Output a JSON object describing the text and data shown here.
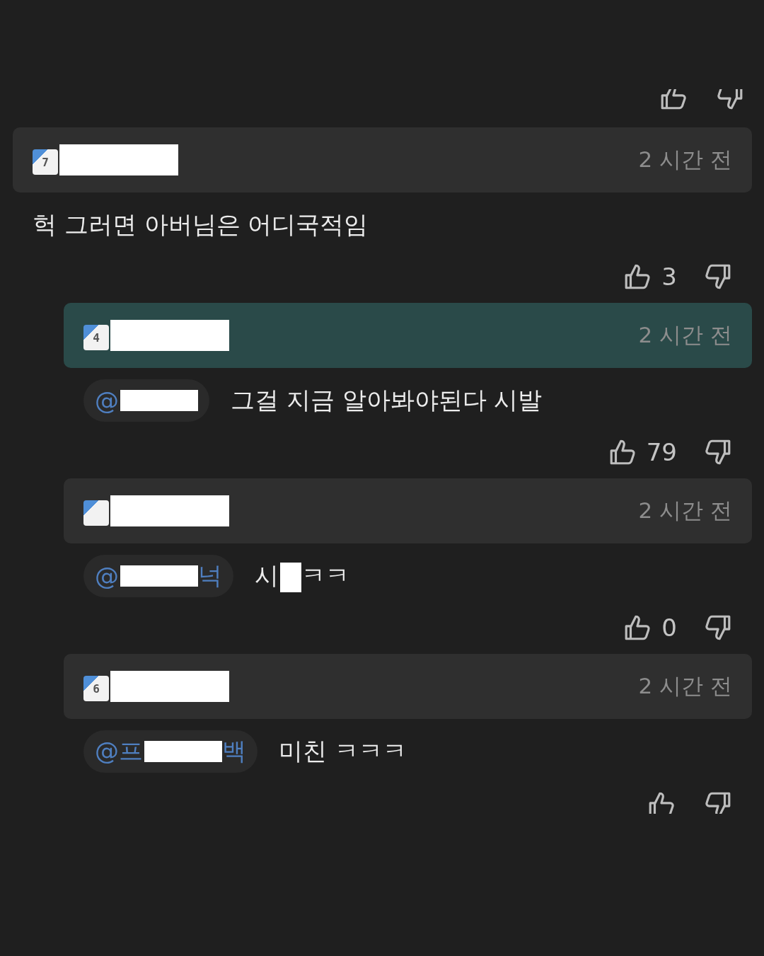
{
  "top_actions": {
    "kind": "cut-top"
  },
  "comments": [
    {
      "reply": false,
      "highlighted": false,
      "level": "7",
      "time": "2 시간 전",
      "text_start": "헉 그러면 아버님은 어디국적임",
      "actions": {
        "kind": "full",
        "likes": "3"
      }
    },
    {
      "reply": true,
      "highlighted": true,
      "level": "4",
      "time": "2 시간 전",
      "mention_start": "@",
      "text_start": "그걸 지금 알아봐야된다 시발",
      "actions": {
        "kind": "full",
        "likes": "79"
      }
    },
    {
      "reply": true,
      "highlighted": false,
      "time": "2 시간 전",
      "mention_start": "@",
      "mention_end": "넉",
      "text_start": "시",
      "text_end": "ㅋㅋ",
      "actions": {
        "kind": "full",
        "likes": "0"
      }
    },
    {
      "reply": true,
      "highlighted": false,
      "level": "6",
      "time": "2 시간 전",
      "mention_start": "@프",
      "mention_end": "백",
      "text_start": "미친 ㅋㅋㅋ",
      "actions": {
        "kind": "cut-bottom"
      }
    }
  ]
}
